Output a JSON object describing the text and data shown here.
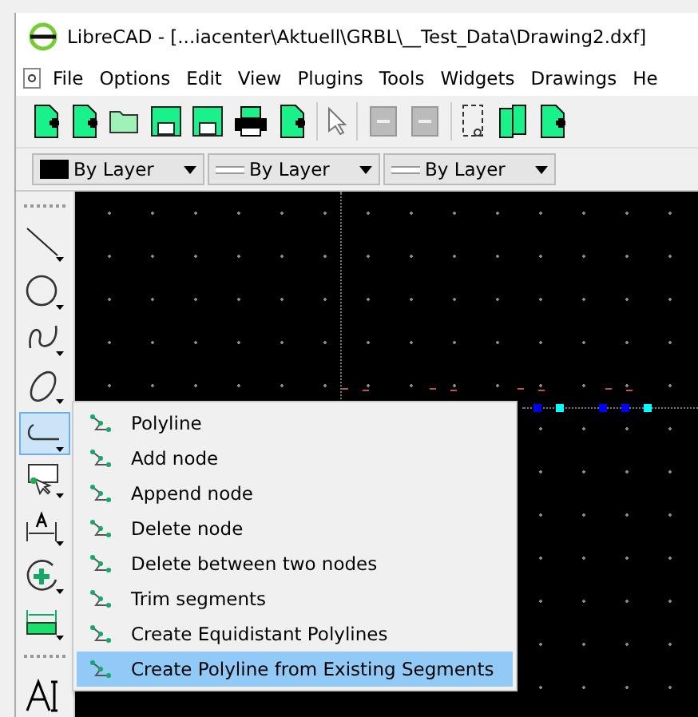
{
  "window": {
    "title": "LibreCAD - [...iacenter\\Aktuell\\GRBL\\__Test_Data\\Drawing2.dxf]"
  },
  "menu": [
    "File",
    "Options",
    "Edit",
    "View",
    "Plugins",
    "Tools",
    "Widgets",
    "Drawings",
    "He"
  ],
  "pen_bar": [
    {
      "kind": "color",
      "label": "By Layer"
    },
    {
      "kind": "line",
      "label": "By Layer"
    },
    {
      "kind": "line",
      "label": "By Layer"
    }
  ],
  "tool_sidebar": [
    {
      "kind": "line",
      "selected": false
    },
    {
      "kind": "circle",
      "selected": false
    },
    {
      "kind": "spline",
      "selected": false
    },
    {
      "kind": "ellipse",
      "selected": false
    },
    {
      "kind": "polyline",
      "selected": true
    },
    {
      "kind": "select",
      "selected": false
    },
    {
      "kind": "dimension",
      "selected": false
    },
    {
      "kind": "modify",
      "selected": false
    },
    {
      "kind": "measure",
      "selected": false
    },
    {
      "kind": "separator"
    },
    {
      "kind": "text",
      "selected": false
    }
  ],
  "popup_menu": {
    "items": [
      {
        "label": "Polyline",
        "selected": false
      },
      {
        "label": "Add node",
        "selected": false
      },
      {
        "label": "Append node",
        "selected": false
      },
      {
        "label": "Delete node",
        "selected": false
      },
      {
        "label": "Delete between two nodes",
        "selected": false
      },
      {
        "label": "Trim segments",
        "selected": false
      },
      {
        "label": "Create Equidistant Polylines",
        "selected": false
      },
      {
        "label": "Create Polyline from Existing Segments",
        "selected": true
      }
    ]
  }
}
